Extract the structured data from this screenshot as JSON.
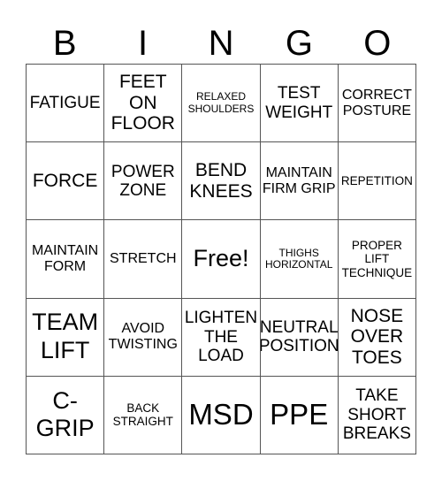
{
  "header": {
    "letters": [
      "B",
      "I",
      "N",
      "G",
      "O"
    ]
  },
  "board": {
    "rows": [
      [
        "FATIGUE",
        "FEET ON FLOOR",
        "RELAXED SHOULDERS",
        "TEST WEIGHT",
        "CORRECT POSTURE"
      ],
      [
        "FORCE",
        "POWER ZONE",
        "BEND KNEES",
        "MAINTAIN FIRM GRIP",
        "REPETITION"
      ],
      [
        "MAINTAIN FORM",
        "STRETCH",
        "Free!",
        "THIGHS HORIZONTAL",
        "PROPER LIFT TECHNIQUE"
      ],
      [
        "TEAM LIFT",
        "AVOID TWISTING",
        "LIGHTEN THE LOAD",
        "NEUTRAL POSITION",
        "NOSE OVER TOES"
      ],
      [
        "C-GRIP",
        "BACK STRAIGHT",
        "MSD",
        "PPE",
        "TAKE SHORT BREAKS"
      ]
    ],
    "free_space": "Free!"
  },
  "colors": {
    "grid_line": "#555555",
    "text": "#000000",
    "background": "#ffffff"
  }
}
